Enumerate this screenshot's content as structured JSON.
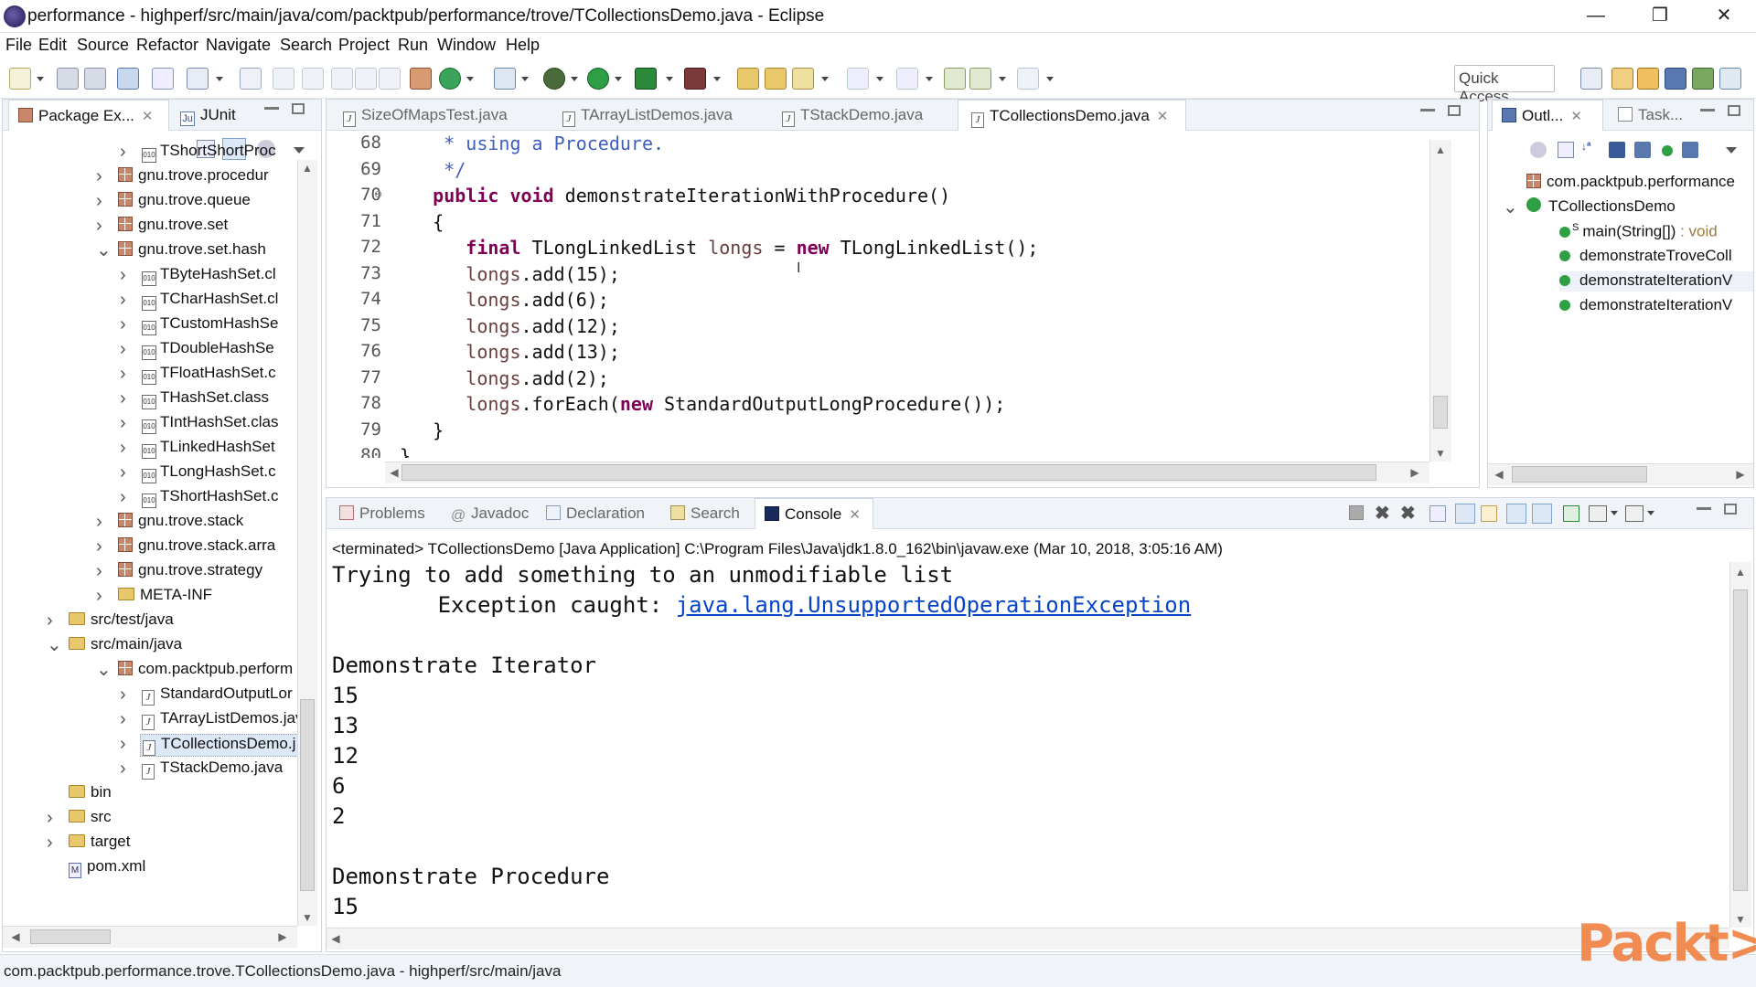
{
  "window": {
    "title": "performance - highperf/src/main/java/com/packtpub/performance/trove/TCollectionsDemo.java - Eclipse",
    "minimize": "—",
    "maximize": "❐",
    "close": "✕"
  },
  "menu": [
    "File",
    "Edit",
    "Source",
    "Refactor",
    "Navigate",
    "Search",
    "Project",
    "Run",
    "Window",
    "Help"
  ],
  "toolbar": {
    "quick_access": "Quick Access"
  },
  "left_panel": {
    "tabs": [
      {
        "label": "Package Ex...",
        "icon": "package-explorer-icon",
        "active": true
      },
      {
        "label": "JUnit",
        "icon": "junit-icon",
        "active": false
      }
    ],
    "tree": [
      {
        "label": "TShortShortProc",
        "icon": "class-file-icon",
        "indent": 3,
        "expander": ">"
      },
      {
        "label": "gnu.trove.procedur",
        "icon": "package-icon",
        "indent": 2,
        "expander": ">"
      },
      {
        "label": "gnu.trove.queue",
        "icon": "package-icon",
        "indent": 2,
        "expander": ">"
      },
      {
        "label": "gnu.trove.set",
        "icon": "package-icon",
        "indent": 2,
        "expander": ">"
      },
      {
        "label": "gnu.trove.set.hash",
        "icon": "package-icon",
        "indent": 2,
        "expander": "v"
      },
      {
        "label": "TByteHashSet.cl",
        "icon": "class-file-icon",
        "indent": 3,
        "expander": ">"
      },
      {
        "label": "TCharHashSet.cl",
        "icon": "class-file-icon",
        "indent": 3,
        "expander": ">"
      },
      {
        "label": "TCustomHashSe",
        "icon": "class-file-icon",
        "indent": 3,
        "expander": ">"
      },
      {
        "label": "TDoubleHashSe",
        "icon": "class-file-icon",
        "indent": 3,
        "expander": ">"
      },
      {
        "label": "TFloatHashSet.c",
        "icon": "class-file-icon",
        "indent": 3,
        "expander": ">"
      },
      {
        "label": "THashSet.class",
        "icon": "class-file-icon",
        "indent": 3,
        "expander": ">"
      },
      {
        "label": "TIntHashSet.clas",
        "icon": "class-file-icon",
        "indent": 3,
        "expander": ">"
      },
      {
        "label": "TLinkedHashSet",
        "icon": "class-file-icon",
        "indent": 3,
        "expander": ">"
      },
      {
        "label": "TLongHashSet.c",
        "icon": "class-file-icon",
        "indent": 3,
        "expander": ">"
      },
      {
        "label": "TShortHashSet.c",
        "icon": "class-file-icon",
        "indent": 3,
        "expander": ">"
      },
      {
        "label": "gnu.trove.stack",
        "icon": "package-icon",
        "indent": 2,
        "expander": ">"
      },
      {
        "label": "gnu.trove.stack.arra",
        "icon": "package-icon",
        "indent": 2,
        "expander": ">"
      },
      {
        "label": "gnu.trove.strategy",
        "icon": "package-icon",
        "indent": 2,
        "expander": ">"
      },
      {
        "label": "META-INF",
        "icon": "folder-icon",
        "indent": 2,
        "expander": ">"
      },
      {
        "label": "src/test/java",
        "icon": "source-folder-icon",
        "indent": 1,
        "expander": ">"
      },
      {
        "label": "src/main/java",
        "icon": "source-folder-icon",
        "indent": 1,
        "expander": "v"
      },
      {
        "label": "com.packtpub.perform",
        "icon": "package-icon",
        "indent": 2,
        "expander": "v"
      },
      {
        "label": "StandardOutputLor",
        "icon": "java-file-icon",
        "indent": 3,
        "expander": ">"
      },
      {
        "label": "TArrayListDemos.jav",
        "icon": "java-file-icon",
        "indent": 3,
        "expander": ">"
      },
      {
        "label": "TCollectionsDemo.j",
        "icon": "java-file-icon",
        "indent": 3,
        "expander": ">",
        "selected": true
      },
      {
        "label": "TStackDemo.java",
        "icon": "java-file-icon",
        "indent": 3,
        "expander": ">"
      },
      {
        "label": "bin",
        "icon": "folder-icon",
        "indent": 1,
        "expander": ""
      },
      {
        "label": "src",
        "icon": "folder-icon",
        "indent": 1,
        "expander": ">"
      },
      {
        "label": "target",
        "icon": "folder-icon",
        "indent": 1,
        "expander": ">"
      },
      {
        "label": "pom.xml",
        "icon": "maven-xml-icon",
        "indent": 1,
        "expander": ""
      }
    ]
  },
  "editor": {
    "tabs": [
      {
        "label": "SizeOfMapsTest.java",
        "active": false
      },
      {
        "label": "TArrayListDemos.java",
        "active": false
      },
      {
        "label": "TStackDemo.java",
        "active": false
      },
      {
        "label": "TCollectionsDemo.java",
        "active": true
      }
    ],
    "lines": [
      {
        "num": "68",
        "segments": [
          {
            "t": "     * using a Procedure.",
            "c": "cm"
          }
        ]
      },
      {
        "num": "69",
        "segments": [
          {
            "t": "     */",
            "c": "cm"
          }
        ]
      },
      {
        "num": "70",
        "fold": true,
        "segments": [
          {
            "t": "    ",
            "c": ""
          },
          {
            "t": "public",
            "c": "kw"
          },
          {
            "t": " ",
            "c": ""
          },
          {
            "t": "void",
            "c": "kw"
          },
          {
            "t": " demonstrateIterationWithProcedure()",
            "c": ""
          }
        ]
      },
      {
        "num": "71",
        "segments": [
          {
            "t": "    {",
            "c": ""
          }
        ]
      },
      {
        "num": "72",
        "segments": [
          {
            "t": "       ",
            "c": ""
          },
          {
            "t": "final",
            "c": "kw"
          },
          {
            "t": " TLongLinkedList ",
            "c": ""
          },
          {
            "t": "longs",
            "c": "vr"
          },
          {
            "t": " = ",
            "c": ""
          },
          {
            "t": "new",
            "c": "kw"
          },
          {
            "t": " TLongLinkedList();",
            "c": ""
          }
        ]
      },
      {
        "num": "73",
        "segments": [
          {
            "t": "       ",
            "c": ""
          },
          {
            "t": "longs",
            "c": "vr"
          },
          {
            "t": ".add(15);",
            "c": ""
          }
        ]
      },
      {
        "num": "74",
        "segments": [
          {
            "t": "       ",
            "c": ""
          },
          {
            "t": "longs",
            "c": "vr"
          },
          {
            "t": ".add(6);",
            "c": ""
          }
        ]
      },
      {
        "num": "75",
        "segments": [
          {
            "t": "       ",
            "c": ""
          },
          {
            "t": "longs",
            "c": "vr"
          },
          {
            "t": ".add(12);",
            "c": ""
          }
        ]
      },
      {
        "num": "76",
        "segments": [
          {
            "t": "       ",
            "c": ""
          },
          {
            "t": "longs",
            "c": "vr"
          },
          {
            "t": ".add(13);",
            "c": ""
          }
        ]
      },
      {
        "num": "77",
        "segments": [
          {
            "t": "       ",
            "c": ""
          },
          {
            "t": "longs",
            "c": "vr"
          },
          {
            "t": ".add(2);",
            "c": ""
          }
        ]
      },
      {
        "num": "78",
        "segments": [
          {
            "t": "       ",
            "c": ""
          },
          {
            "t": "longs",
            "c": "vr"
          },
          {
            "t": ".forEach(",
            "c": ""
          },
          {
            "t": "new",
            "c": "kw"
          },
          {
            "t": " StandardOutputLongProcedure());",
            "c": ""
          }
        ]
      },
      {
        "num": "79",
        "segments": [
          {
            "t": "    }",
            "c": ""
          }
        ]
      },
      {
        "num": "80",
        "segments": [
          {
            "t": " }",
            "c": ""
          }
        ]
      }
    ]
  },
  "outline": {
    "tabs": [
      {
        "label": "Outl...",
        "active": true
      },
      {
        "label": "Task...",
        "active": false
      }
    ],
    "items": [
      {
        "label": "com.packtpub.performance",
        "icon": "package-icon",
        "indent": 0
      },
      {
        "label": "TCollectionsDemo",
        "icon": "class-icon",
        "indent": 0,
        "expander": "v"
      },
      {
        "label": "main(String[])",
        "suffix": " : void",
        "icon": "public-static-method-icon",
        "indent": 1,
        "sup": "S"
      },
      {
        "label": "demonstrateTroveColl",
        "icon": "public-method-icon",
        "indent": 1
      },
      {
        "label": "demonstrateIterationV",
        "icon": "public-method-icon",
        "indent": 1,
        "selected": true
      },
      {
        "label": "demonstrateIterationV",
        "icon": "public-method-icon",
        "indent": 1
      }
    ]
  },
  "bottom": {
    "tabs": [
      {
        "label": "Problems",
        "icon": "problems-icon",
        "active": false
      },
      {
        "label": "Javadoc",
        "icon": "javadoc-icon",
        "active": false
      },
      {
        "label": "Declaration",
        "icon": "declaration-icon",
        "active": false
      },
      {
        "label": "Search",
        "icon": "search-icon",
        "active": false
      },
      {
        "label": "Console",
        "icon": "console-icon",
        "active": true
      }
    ],
    "console_header": "<terminated> TCollectionsDemo [Java Application] C:\\Program Files\\Java\\jdk1.8.0_162\\bin\\javaw.exe (Mar 10, 2018, 3:05:16 AM)",
    "console_lines": [
      {
        "text": "Trying to add something to an unmodifiable list"
      },
      {
        "text": "        Exception caught: ",
        "link": "java.lang.UnsupportedOperationException"
      },
      {
        "text": ""
      },
      {
        "text": "Demonstrate Iterator"
      },
      {
        "text": "15"
      },
      {
        "text": "13"
      },
      {
        "text": "12"
      },
      {
        "text": "6"
      },
      {
        "text": "2"
      },
      {
        "text": ""
      },
      {
        "text": "Demonstrate Procedure"
      },
      {
        "text": "15"
      }
    ]
  },
  "status_bar": {
    "text": "com.packtpub.performance.trove.TCollectionsDemo.java - highperf/src/main/java"
  },
  "watermark": {
    "text": "Packt>"
  },
  "colors": {
    "keyword": "#7f0055",
    "comment": "#3f5fbf",
    "variable": "#6a3e3e",
    "link": "#0645c8",
    "watermark": "#f08040"
  }
}
